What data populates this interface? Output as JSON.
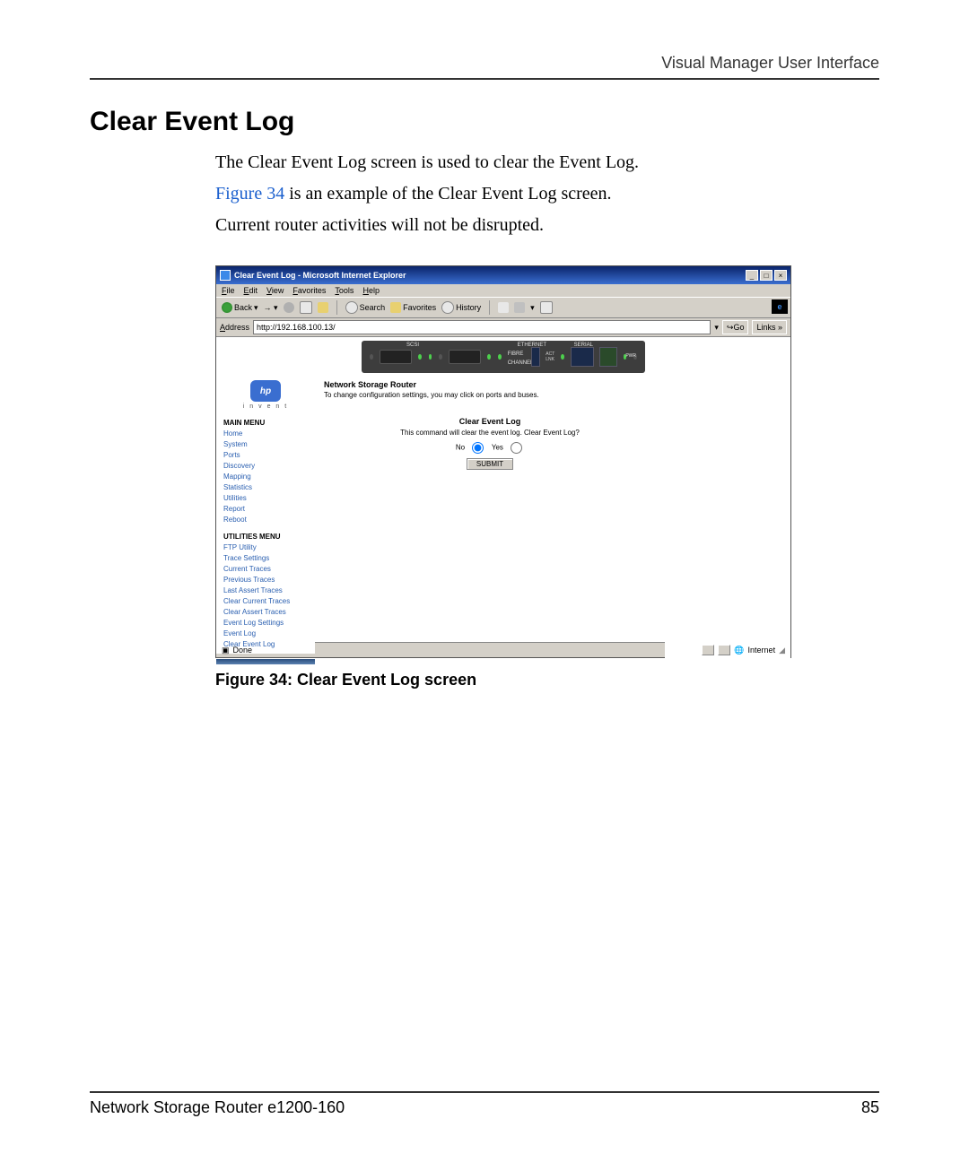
{
  "header": {
    "right": "Visual Manager User Interface"
  },
  "title": "Clear Event Log",
  "paragraphs": {
    "p1": "The Clear Event Log screen is used to clear the Event Log.",
    "figref": "Figure 34",
    "p2_rest": " is an example of the Clear Event Log screen.",
    "p3": "Current router activities will not be disrupted."
  },
  "browser": {
    "title": "Clear Event Log - Microsoft Internet Explorer",
    "menus": [
      "File",
      "Edit",
      "View",
      "Favorites",
      "Tools",
      "Help"
    ],
    "toolbar": {
      "back": "Back",
      "search": "Search",
      "favorites": "Favorites",
      "history": "History"
    },
    "address_label": "Address",
    "address_value": "http://192.168.100.13/",
    "go": "Go",
    "links": "Links »"
  },
  "device": {
    "labels": {
      "scsi": "SCSI",
      "ethernet": "ETHERNET",
      "serial": "SERIAL",
      "fibre": "FIBRE CHANNEL",
      "act": "ACT",
      "lnk": "LNK",
      "pwr": "PWR"
    }
  },
  "router": {
    "title": "Network Storage Router",
    "sub": "To change configuration settings, you may click on ports and buses."
  },
  "hp": {
    "logo": "hp",
    "invent": "i n v e n t"
  },
  "nav": {
    "main_title": "MAIN MENU",
    "main_items": [
      "Home",
      "System",
      "Ports",
      "Discovery",
      "Mapping",
      "Statistics",
      "Utilities",
      "Report",
      "Reboot"
    ],
    "util_title": "UTILITIES MENU",
    "util_items": [
      "FTP Utility",
      "Trace Settings",
      "Current Traces",
      "Previous Traces",
      "Last Assert Traces",
      "Clear Current Traces",
      "Clear Assert Traces",
      "Event Log Settings",
      "Event Log",
      "Clear Event Log"
    ]
  },
  "form": {
    "heading": "Clear Event Log",
    "msg": "This command will clear the event log. Clear Event Log?",
    "no": "No",
    "yes": "Yes",
    "submit": "SUBMIT"
  },
  "statusbar": {
    "done": "Done",
    "zone": "Internet"
  },
  "caption": "Figure 34:  Clear Event Log screen",
  "footer": {
    "left": "Network Storage Router e1200-160",
    "right": "85"
  }
}
